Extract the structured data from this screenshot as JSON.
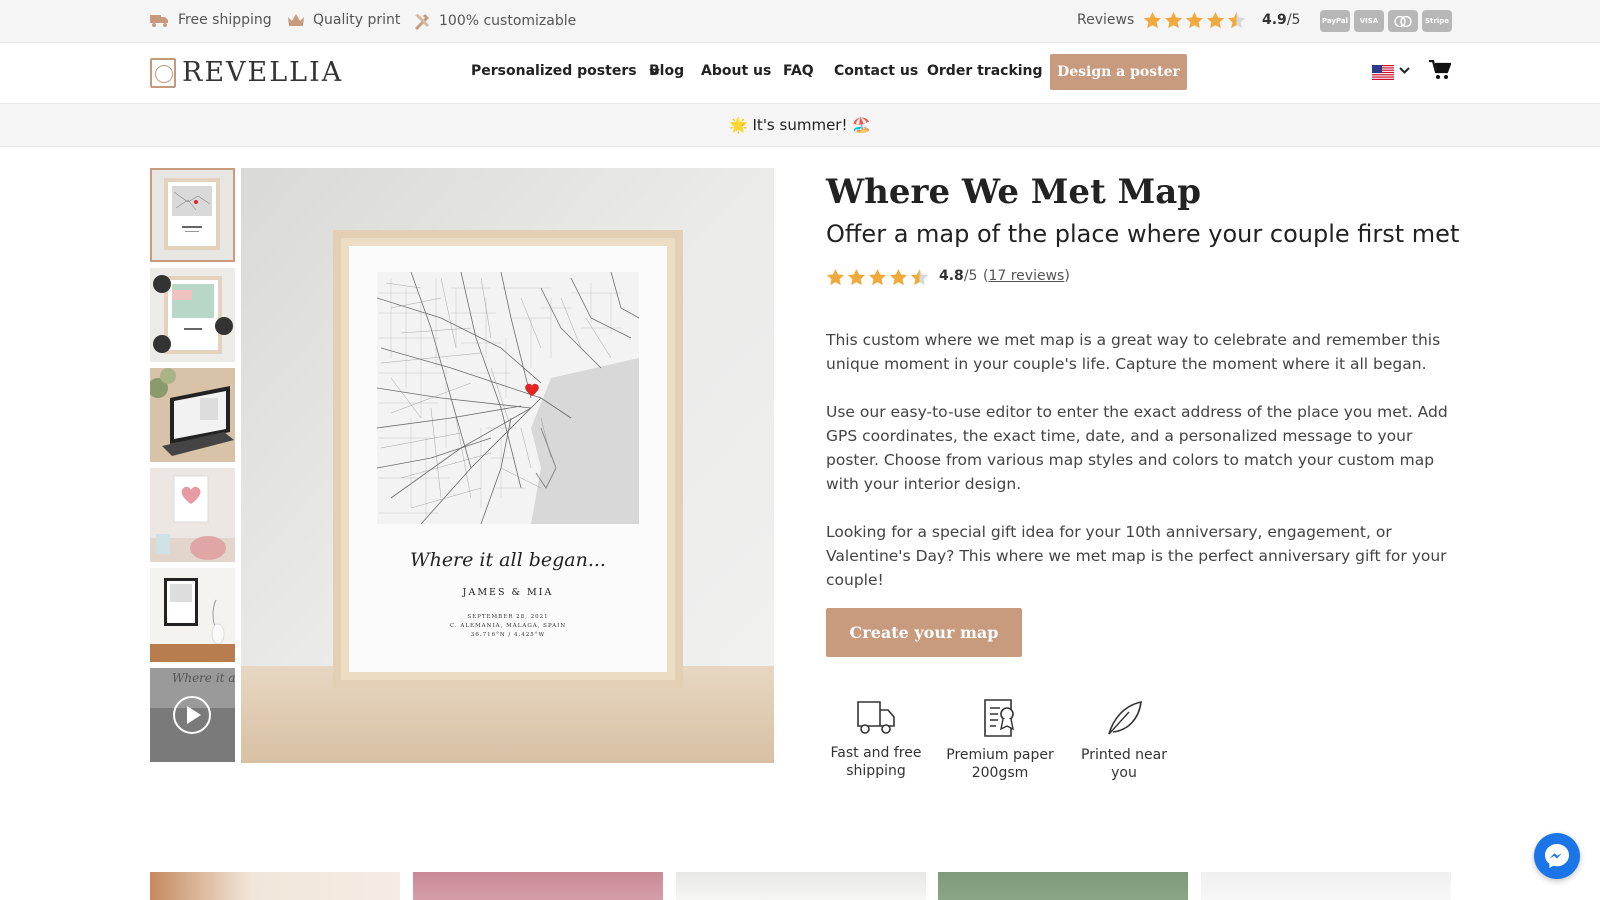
{
  "topbar": {
    "perks": [
      {
        "icon": "truck-icon",
        "label": "Free shipping"
      },
      {
        "icon": "crown-icon",
        "label": "Quality print"
      },
      {
        "icon": "tools-icon",
        "label": "100% customizable"
      }
    ],
    "reviews_label": "Reviews",
    "rating_value": "4.9",
    "rating_max": "/5",
    "payment_methods": [
      "PayPal",
      "VISA",
      "Mastercard",
      "Stripe"
    ]
  },
  "header": {
    "logo_text": "REVELLIA",
    "nav": [
      {
        "label": "Personalized posters",
        "has_dropdown": true
      },
      {
        "label": "Blog"
      },
      {
        "label": "About us"
      },
      {
        "label": "FAQ"
      },
      {
        "label": "Contact us"
      },
      {
        "label": "Order tracking"
      }
    ],
    "cta_label": "Design a poster",
    "language_icon": "us-flag-icon",
    "cart_icon": "cart-icon"
  },
  "banner": {
    "text": "🌟 It's summer! 🏖️"
  },
  "gallery": {
    "thumbnails": [
      "framed-map-poster",
      "map-poster-with-badges",
      "laptop-editor",
      "heart-poster-in-room",
      "black-frame-poster",
      "video-thumbnail"
    ],
    "poster": {
      "script_line": "Where it all began...",
      "names": "JAMES & MIA",
      "date": "SEPTEMBER 28, 2021",
      "place": "C. ALEMANIA, MÁLAGA, SPAIN",
      "coords": "36.716°N / 4.425°W"
    }
  },
  "product": {
    "title": "Where We Met Map",
    "subtitle": "Offer a map of the place where your couple first met",
    "rating_value": "4.8",
    "rating_max": "/5",
    "reviews_open": "(",
    "reviews_link": "17 reviews",
    "reviews_close": ")",
    "paragraphs": [
      "This custom where we met map is a great way to celebrate and remember this unique moment in your couple's life. Capture the moment where it all began.",
      "Use our easy-to-use editor to enter the exact address of the place you met. Add GPS coordinates, the exact time, date, and a personalized message to your poster. Choose from various map styles and colors to match your custom map with your interior design.",
      "Looking for a special gift idea for your 10th anniversary, engagement, or Valentine's Day? This where we met map is the perfect anniversary gift for your couple!"
    ],
    "cta_label": "Create your map",
    "features": [
      {
        "icon": "delivery-truck-icon",
        "label": "Fast and free shipping"
      },
      {
        "icon": "certificate-paper-icon",
        "label": "Premium paper 200gsm"
      },
      {
        "icon": "feather-leaf-icon",
        "label": "Printed near you"
      }
    ]
  },
  "colors": {
    "accent": "#c89b7f",
    "star": "#f1a93b",
    "messenger": "#1a75e8"
  }
}
